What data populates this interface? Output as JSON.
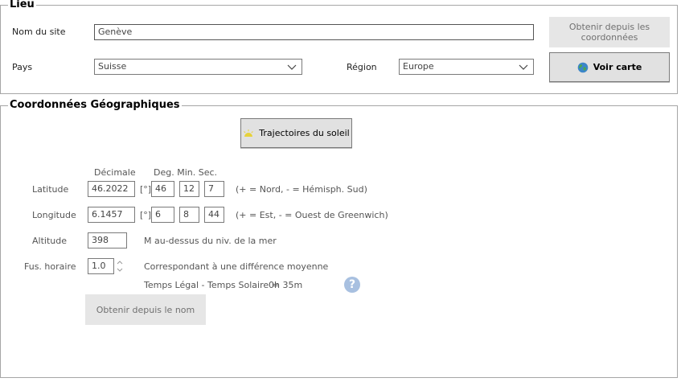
{
  "lieu": {
    "legend": "Lieu",
    "site_label": "Nom du site",
    "site_value": "Genève",
    "pays_label": "Pays",
    "pays_value": "Suisse",
    "region_label": "Région",
    "region_value": "Europe",
    "obtain_coords_button": "Obtenir depuis les coordonnées",
    "voir_carte_button": "Voir carte"
  },
  "coords": {
    "legend": "Coordonnées Géographiques",
    "trajectoires_button": "Trajectoires du soleil",
    "decimal_header": "Décimale",
    "dms_header": "Deg. Min. Sec.",
    "degree_unit": "[°]",
    "latitude": {
      "label": "Latitude",
      "decimal": "46.2022",
      "deg": "46",
      "min": "12",
      "sec": "7",
      "hint": "(+ = Nord, - = Hémisph. Sud)"
    },
    "longitude": {
      "label": "Longitude",
      "decimal": "6.1457",
      "deg": "6",
      "min": "8",
      "sec": "44",
      "hint": "(+ = Est, - = Ouest de Greenwich)"
    },
    "altitude": {
      "label": "Altitude",
      "value": "398",
      "hint": "M au-dessus du niv. de la mer"
    },
    "fuseau": {
      "label": "Fus. horaire",
      "value": "1.0",
      "hint": "Correspondant à une différence moyenne",
      "diff_label": "Temps Légal - Temps Solaire =",
      "diff_value": "0h 35m"
    },
    "obtain_name_button": "Obtenir depuis le nom"
  },
  "icons": {
    "globe": "globe-icon",
    "sun": "sun-icon",
    "help": "help-icon"
  },
  "colors": {
    "help_icon": "#a8c0e0",
    "flat_button": "#e6e6e6"
  }
}
